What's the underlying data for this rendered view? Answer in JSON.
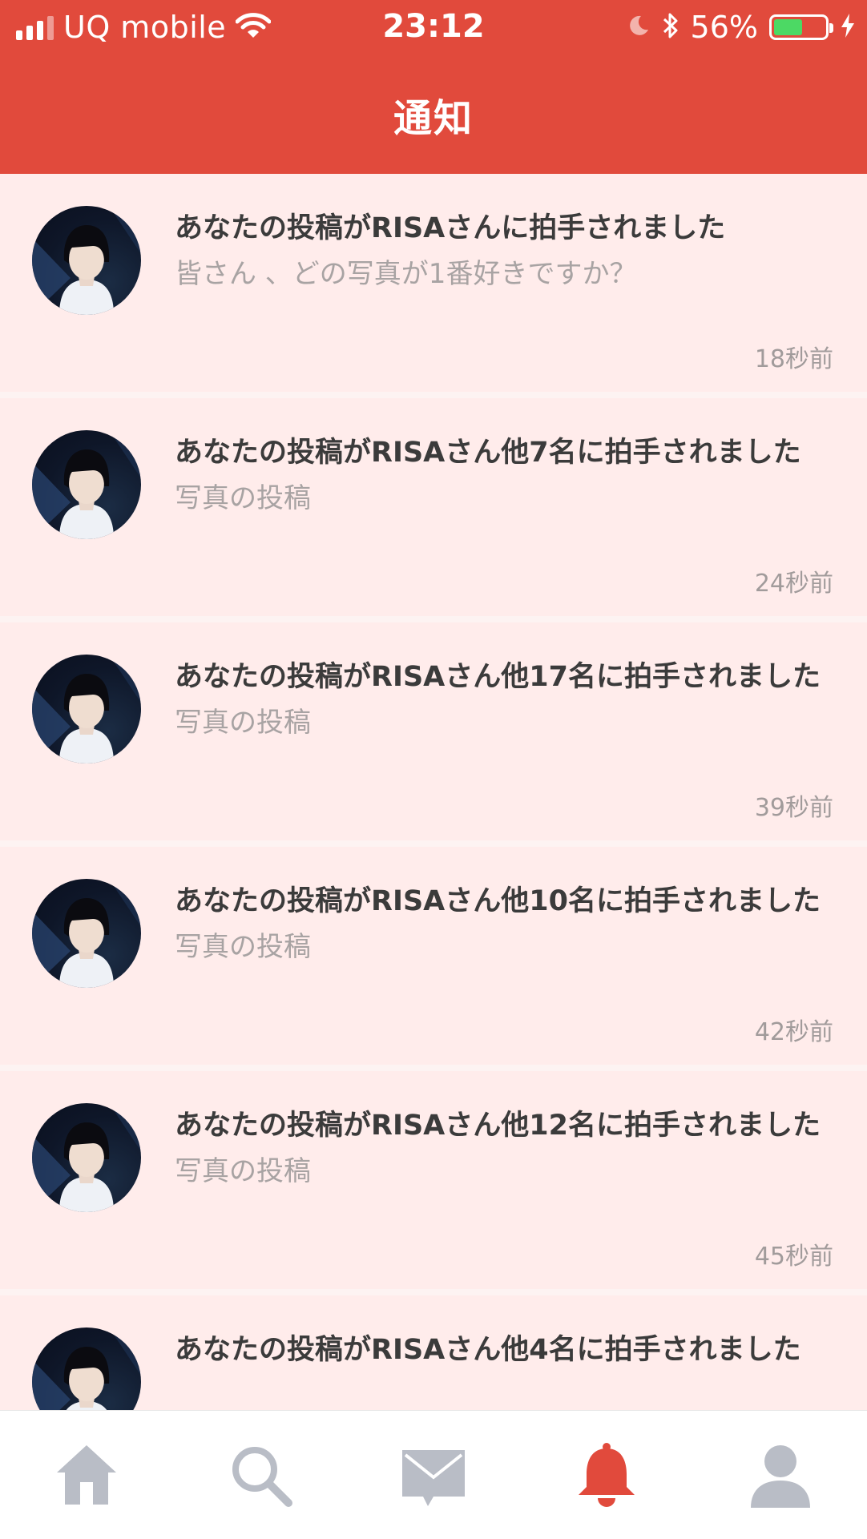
{
  "status_bar": {
    "carrier": "UQ mobile",
    "time": "23:12",
    "battery_percent": "56%",
    "battery_level": 0.56
  },
  "header": {
    "title": "通知"
  },
  "notifications": [
    {
      "title": "あなたの投稿がRISAさんに拍手されました",
      "subtitle": "皆さん 、どの写真が1番好きですか？",
      "time": "18秒前"
    },
    {
      "title": "あなたの投稿がRISAさん他7名に拍手されました",
      "subtitle": "写真の投稿",
      "time": "24秒前"
    },
    {
      "title": "あなたの投稿がRISAさん他17名に拍手されました",
      "subtitle": "写真の投稿",
      "time": "39秒前"
    },
    {
      "title": "あなたの投稿がRISAさん他10名に拍手されました",
      "subtitle": "写真の投稿",
      "time": "42秒前"
    },
    {
      "title": "あなたの投稿がRISAさん他12名に拍手されました",
      "subtitle": "写真の投稿",
      "time": "45秒前"
    },
    {
      "title": "あなたの投稿がRISAさん他4名に拍手されました",
      "subtitle": "",
      "time": ""
    }
  ],
  "tabbar": {
    "items": [
      {
        "icon": "home-icon",
        "active": false
      },
      {
        "icon": "search-icon",
        "active": false
      },
      {
        "icon": "mail-icon",
        "active": false
      },
      {
        "icon": "bell-icon",
        "active": true
      },
      {
        "icon": "profile-icon",
        "active": false
      }
    ]
  },
  "colors": {
    "accent": "#e14a3c",
    "list_background": "#ffeceb",
    "inactive_icon": "#b9bdc6",
    "battery_fill": "#4cd964"
  }
}
